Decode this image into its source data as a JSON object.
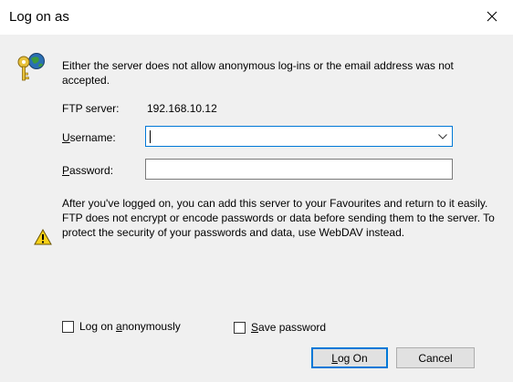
{
  "window": {
    "title": "Log on as"
  },
  "message": {
    "intro": "Either the server does not allow anonymous log-ins or the email address was not accepted."
  },
  "form": {
    "ftp_server_label": "FTP server:",
    "ftp_server_value": "192.168.10.12",
    "username_label_accel": "U",
    "username_label_rest": "sername:",
    "username_value": "",
    "password_label_accel": "P",
    "password_label_rest": "assword:",
    "password_value": ""
  },
  "info": {
    "line1": "After you've logged on, you can add this server to your Favourites and return to it easily.",
    "line2": "FTP does not encrypt or encode passwords or data before sending them to the server. To protect the security of your passwords and data, use WebDAV instead."
  },
  "options": {
    "anonymous_pre": "Log on ",
    "anonymous_accel": "a",
    "anonymous_post": "nonymously",
    "anonymous_checked": false,
    "save_accel": "S",
    "save_rest": "ave password",
    "save_checked": false
  },
  "buttons": {
    "logon_accel": "L",
    "logon_rest": "og On",
    "cancel": "Cancel"
  },
  "icons": {
    "close": "close-icon",
    "keys": "keys-globe-icon",
    "warning": "warning-icon",
    "dropdown": "chevron-down-icon"
  },
  "colors": {
    "focus_border": "#0078d7",
    "dialog_bg": "#f0f0f0",
    "button_bg": "#e1e1e1"
  }
}
